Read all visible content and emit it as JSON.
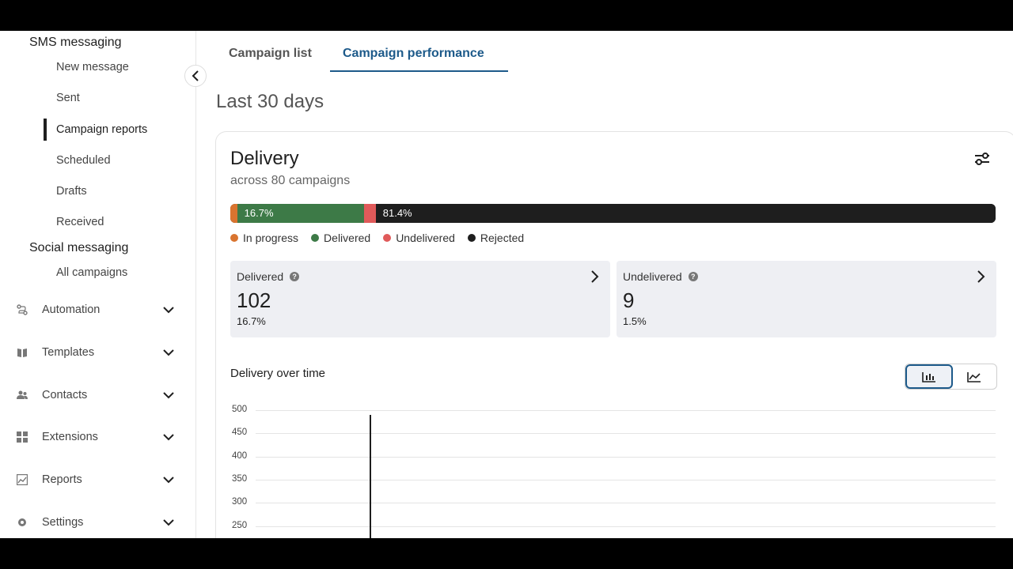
{
  "sidebar": {
    "sms_section": "SMS messaging",
    "sms_items": [
      {
        "label": "New message"
      },
      {
        "label": "Sent"
      },
      {
        "label": "Campaign reports",
        "active": true
      },
      {
        "label": "Scheduled"
      },
      {
        "label": "Drafts"
      },
      {
        "label": "Received"
      }
    ],
    "social_section": "Social messaging",
    "social_items": [
      {
        "label": "All campaigns"
      }
    ],
    "groups": [
      {
        "label": "Automation",
        "icon": "automation-icon"
      },
      {
        "label": "Templates",
        "icon": "templates-icon"
      },
      {
        "label": "Contacts",
        "icon": "contacts-icon"
      },
      {
        "label": "Extensions",
        "icon": "extensions-icon"
      },
      {
        "label": "Reports",
        "icon": "reports-icon"
      },
      {
        "label": "Settings",
        "icon": "settings-icon"
      }
    ]
  },
  "tabs": [
    {
      "label": "Campaign list",
      "active": false
    },
    {
      "label": "Campaign performance",
      "active": true
    }
  ],
  "page": {
    "title": "Last 30 days"
  },
  "delivery": {
    "title": "Delivery",
    "subtitle": "across 80 campaigns",
    "segments": [
      {
        "name": "In progress",
        "pct": 0.9,
        "color": "#d9742f",
        "label": ""
      },
      {
        "name": "Delivered",
        "pct": 16.7,
        "color": "#3d7a47",
        "label": "16.7%"
      },
      {
        "name": "Undelivered",
        "pct": 1.5,
        "color": "#e05a5a",
        "label": ""
      },
      {
        "name": "Rejected",
        "pct": 81.4,
        "color": "#1e1e1e",
        "label": "81.4%"
      }
    ],
    "legend": [
      {
        "label": "In progress",
        "color": "#d9742f"
      },
      {
        "label": "Delivered",
        "color": "#3d7a47"
      },
      {
        "label": "Undelivered",
        "color": "#e05a5a"
      },
      {
        "label": "Rejected",
        "color": "#1e1e1e"
      }
    ],
    "stats": [
      {
        "label": "Delivered",
        "value": "102",
        "pct": "16.7%"
      },
      {
        "label": "Undelivered",
        "value": "9",
        "pct": "1.5%"
      }
    ]
  },
  "chart": {
    "title": "Delivery over time"
  },
  "chart_data": {
    "type": "bar",
    "title": "Delivery over time",
    "yticks": [
      "500",
      "450",
      "400",
      "350",
      "300",
      "250"
    ],
    "ylim_visible": [
      250,
      500
    ],
    "bars": [
      {
        "x_index": 0,
        "value": 490
      }
    ]
  },
  "colors": {
    "accent": "#1d5a8a",
    "in_progress": "#d9742f",
    "delivered": "#3d7a47",
    "undelivered": "#e05a5a",
    "rejected": "#1e1e1e"
  }
}
